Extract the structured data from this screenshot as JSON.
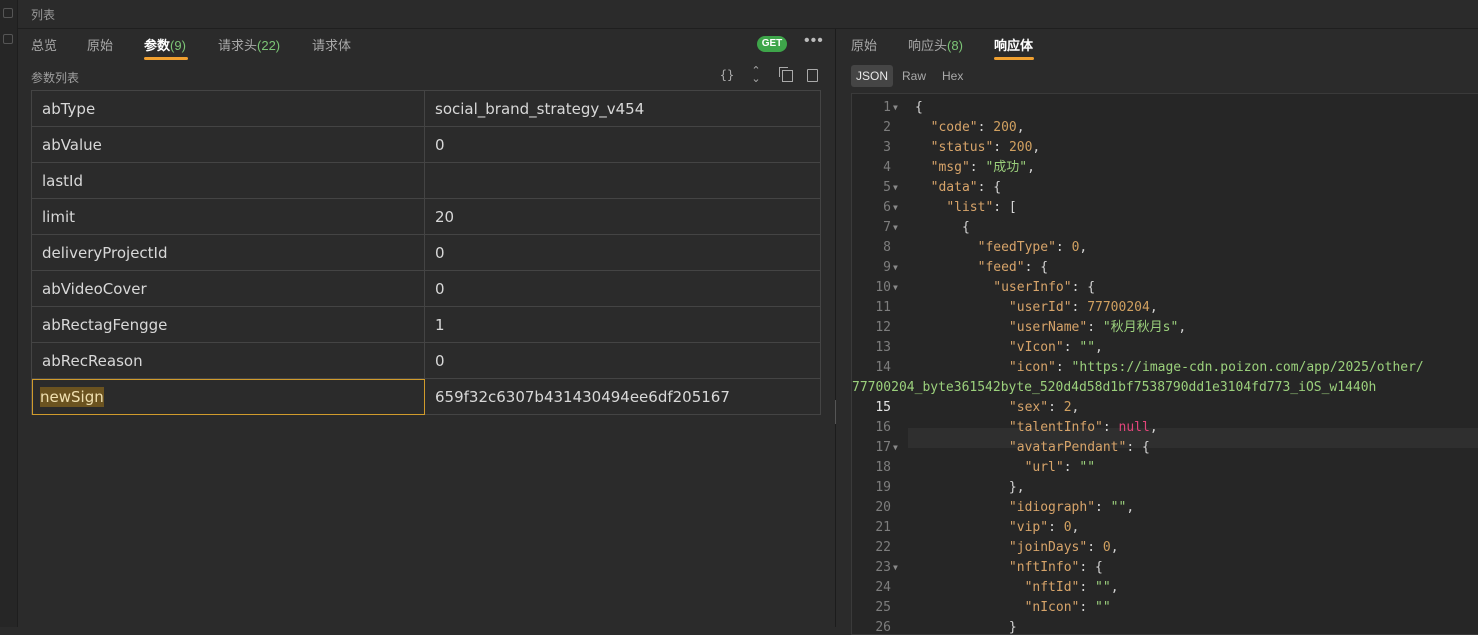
{
  "window": {
    "section_title": "列表"
  },
  "left": {
    "tabs": [
      {
        "label": "总览",
        "count": ""
      },
      {
        "label": "原始",
        "count": ""
      },
      {
        "label": "参数",
        "count": "(9)"
      },
      {
        "label": "请求头",
        "count": "(22)"
      },
      {
        "label": "请求体",
        "count": ""
      }
    ],
    "active_tab": "参数",
    "method_badge": "GET",
    "more_label": "•••",
    "params_label": "参数列表",
    "params": [
      {
        "key": "abType",
        "value": "social_brand_strategy_v454"
      },
      {
        "key": "abValue",
        "value": "0"
      },
      {
        "key": "lastId",
        "value": ""
      },
      {
        "key": "limit",
        "value": "20"
      },
      {
        "key": "deliveryProjectId",
        "value": "0"
      },
      {
        "key": "abVideoCover",
        "value": "0"
      },
      {
        "key": "abRectagFengge",
        "value": "1"
      },
      {
        "key": "abRecReason",
        "value": "0"
      },
      {
        "key": "newSign",
        "value": "659f32c6307b431430494ee6df205167"
      }
    ],
    "selected_param": "newSign",
    "tool_icons": [
      "braces-icon",
      "expand-collapse-icon",
      "copy-icon",
      "file-icon"
    ]
  },
  "right": {
    "tabs": [
      {
        "label": "原始",
        "count": ""
      },
      {
        "label": "响应头",
        "count": "(8)"
      },
      {
        "label": "响应体",
        "count": ""
      }
    ],
    "active_tab": "响应体",
    "formats": [
      "JSON",
      "Raw",
      "Hex"
    ],
    "active_format": "JSON",
    "current_line": "15"
  },
  "colors": {
    "accent": "#f0a030",
    "count_green": "#7cc576",
    "get_badge": "#3ea54a",
    "json_key": "#d7a46a",
    "json_string": "#9bd07c",
    "json_null": "#e0457a"
  }
}
